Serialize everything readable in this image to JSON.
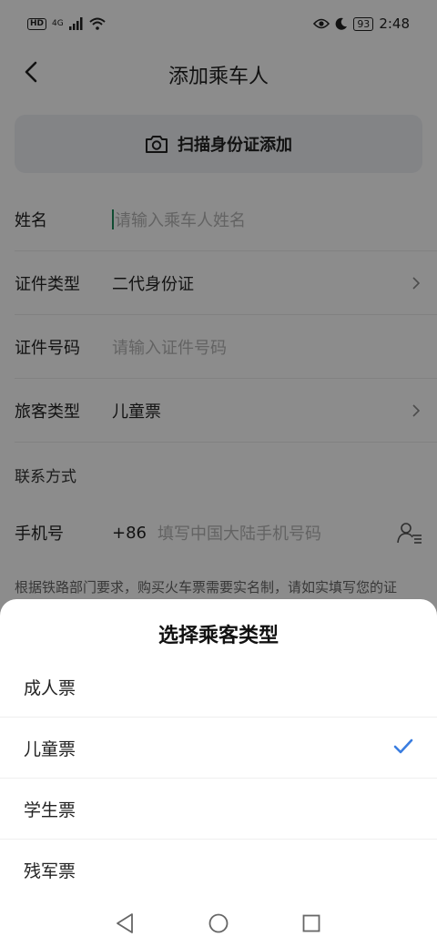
{
  "status_bar": {
    "hd": "HD",
    "network": "4G",
    "battery": "93",
    "time": "2:48"
  },
  "header": {
    "title": "添加乘车人"
  },
  "scan": {
    "label": "扫描身份证添加"
  },
  "form": {
    "name": {
      "label": "姓名",
      "placeholder": "请输入乘车人姓名"
    },
    "id_type": {
      "label": "证件类型",
      "value": "二代身份证"
    },
    "id_number": {
      "label": "证件号码",
      "placeholder": "请输入证件号码"
    },
    "passenger_type": {
      "label": "旅客类型",
      "value": "儿童票"
    },
    "contact_section": "联系方式",
    "phone": {
      "label": "手机号",
      "prefix": "+86",
      "placeholder": "填写中国大陆手机号码"
    },
    "notice": "根据铁路部门要求，购买火车票需要实名制，请如实填写您的证"
  },
  "sheet": {
    "title": "选择乘客类型",
    "options": [
      {
        "label": "成人票",
        "selected": false
      },
      {
        "label": "儿童票",
        "selected": true
      },
      {
        "label": "学生票",
        "selected": false
      },
      {
        "label": "残军票",
        "selected": false
      }
    ],
    "check_color": "#3a7de0"
  }
}
